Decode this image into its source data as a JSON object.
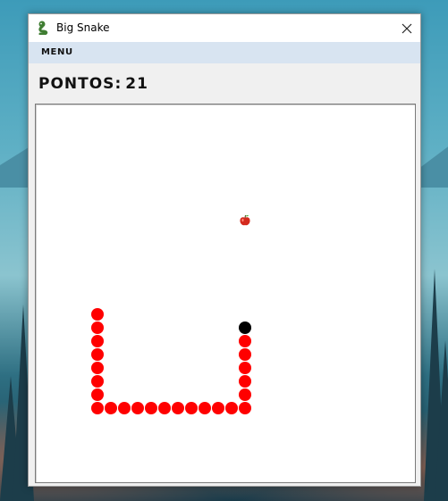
{
  "window": {
    "title": "Big Snake",
    "menu_label": "MENU"
  },
  "score": {
    "label": "PONTOS",
    "separator": ":",
    "value": "21"
  },
  "game": {
    "grid_cols": 28,
    "grid_rows": 28,
    "snake_color": "#ff0000",
    "head_color": "#000000",
    "apple_icon": "apple-icon",
    "apple_cell": [
      15,
      8
    ],
    "snake_cells": [
      [
        15,
        16
      ],
      [
        15,
        17
      ],
      [
        15,
        18
      ],
      [
        15,
        19
      ],
      [
        15,
        20
      ],
      [
        15,
        21
      ],
      [
        15,
        22
      ],
      [
        14,
        22
      ],
      [
        13,
        22
      ],
      [
        12,
        22
      ],
      [
        11,
        22
      ],
      [
        10,
        22
      ],
      [
        9,
        22
      ],
      [
        8,
        22
      ],
      [
        7,
        22
      ],
      [
        6,
        22
      ],
      [
        5,
        22
      ],
      [
        4,
        22
      ],
      [
        4,
        21
      ],
      [
        4,
        20
      ],
      [
        4,
        19
      ],
      [
        4,
        18
      ],
      [
        4,
        17
      ],
      [
        4,
        16
      ],
      [
        4,
        15
      ]
    ]
  }
}
